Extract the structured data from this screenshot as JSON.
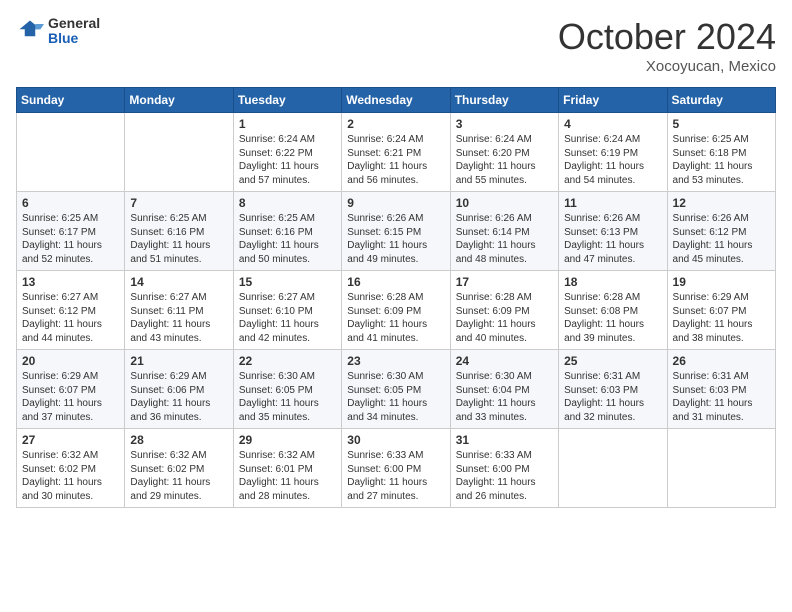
{
  "header": {
    "logo_general": "General",
    "logo_blue": "Blue",
    "month_title": "October 2024",
    "location": "Xocoyucan, Mexico"
  },
  "weekdays": [
    "Sunday",
    "Monday",
    "Tuesday",
    "Wednesday",
    "Thursday",
    "Friday",
    "Saturday"
  ],
  "weeks": [
    [
      {
        "day": "",
        "info": ""
      },
      {
        "day": "",
        "info": ""
      },
      {
        "day": "1",
        "info": "Sunrise: 6:24 AM\nSunset: 6:22 PM\nDaylight: 11 hours and 57 minutes."
      },
      {
        "day": "2",
        "info": "Sunrise: 6:24 AM\nSunset: 6:21 PM\nDaylight: 11 hours and 56 minutes."
      },
      {
        "day": "3",
        "info": "Sunrise: 6:24 AM\nSunset: 6:20 PM\nDaylight: 11 hours and 55 minutes."
      },
      {
        "day": "4",
        "info": "Sunrise: 6:24 AM\nSunset: 6:19 PM\nDaylight: 11 hours and 54 minutes."
      },
      {
        "day": "5",
        "info": "Sunrise: 6:25 AM\nSunset: 6:18 PM\nDaylight: 11 hours and 53 minutes."
      }
    ],
    [
      {
        "day": "6",
        "info": "Sunrise: 6:25 AM\nSunset: 6:17 PM\nDaylight: 11 hours and 52 minutes."
      },
      {
        "day": "7",
        "info": "Sunrise: 6:25 AM\nSunset: 6:16 PM\nDaylight: 11 hours and 51 minutes."
      },
      {
        "day": "8",
        "info": "Sunrise: 6:25 AM\nSunset: 6:16 PM\nDaylight: 11 hours and 50 minutes."
      },
      {
        "day": "9",
        "info": "Sunrise: 6:26 AM\nSunset: 6:15 PM\nDaylight: 11 hours and 49 minutes."
      },
      {
        "day": "10",
        "info": "Sunrise: 6:26 AM\nSunset: 6:14 PM\nDaylight: 11 hours and 48 minutes."
      },
      {
        "day": "11",
        "info": "Sunrise: 6:26 AM\nSunset: 6:13 PM\nDaylight: 11 hours and 47 minutes."
      },
      {
        "day": "12",
        "info": "Sunrise: 6:26 AM\nSunset: 6:12 PM\nDaylight: 11 hours and 45 minutes."
      }
    ],
    [
      {
        "day": "13",
        "info": "Sunrise: 6:27 AM\nSunset: 6:12 PM\nDaylight: 11 hours and 44 minutes."
      },
      {
        "day": "14",
        "info": "Sunrise: 6:27 AM\nSunset: 6:11 PM\nDaylight: 11 hours and 43 minutes."
      },
      {
        "day": "15",
        "info": "Sunrise: 6:27 AM\nSunset: 6:10 PM\nDaylight: 11 hours and 42 minutes."
      },
      {
        "day": "16",
        "info": "Sunrise: 6:28 AM\nSunset: 6:09 PM\nDaylight: 11 hours and 41 minutes."
      },
      {
        "day": "17",
        "info": "Sunrise: 6:28 AM\nSunset: 6:09 PM\nDaylight: 11 hours and 40 minutes."
      },
      {
        "day": "18",
        "info": "Sunrise: 6:28 AM\nSunset: 6:08 PM\nDaylight: 11 hours and 39 minutes."
      },
      {
        "day": "19",
        "info": "Sunrise: 6:29 AM\nSunset: 6:07 PM\nDaylight: 11 hours and 38 minutes."
      }
    ],
    [
      {
        "day": "20",
        "info": "Sunrise: 6:29 AM\nSunset: 6:07 PM\nDaylight: 11 hours and 37 minutes."
      },
      {
        "day": "21",
        "info": "Sunrise: 6:29 AM\nSunset: 6:06 PM\nDaylight: 11 hours and 36 minutes."
      },
      {
        "day": "22",
        "info": "Sunrise: 6:30 AM\nSunset: 6:05 PM\nDaylight: 11 hours and 35 minutes."
      },
      {
        "day": "23",
        "info": "Sunrise: 6:30 AM\nSunset: 6:05 PM\nDaylight: 11 hours and 34 minutes."
      },
      {
        "day": "24",
        "info": "Sunrise: 6:30 AM\nSunset: 6:04 PM\nDaylight: 11 hours and 33 minutes."
      },
      {
        "day": "25",
        "info": "Sunrise: 6:31 AM\nSunset: 6:03 PM\nDaylight: 11 hours and 32 minutes."
      },
      {
        "day": "26",
        "info": "Sunrise: 6:31 AM\nSunset: 6:03 PM\nDaylight: 11 hours and 31 minutes."
      }
    ],
    [
      {
        "day": "27",
        "info": "Sunrise: 6:32 AM\nSunset: 6:02 PM\nDaylight: 11 hours and 30 minutes."
      },
      {
        "day": "28",
        "info": "Sunrise: 6:32 AM\nSunset: 6:02 PM\nDaylight: 11 hours and 29 minutes."
      },
      {
        "day": "29",
        "info": "Sunrise: 6:32 AM\nSunset: 6:01 PM\nDaylight: 11 hours and 28 minutes."
      },
      {
        "day": "30",
        "info": "Sunrise: 6:33 AM\nSunset: 6:00 PM\nDaylight: 11 hours and 27 minutes."
      },
      {
        "day": "31",
        "info": "Sunrise: 6:33 AM\nSunset: 6:00 PM\nDaylight: 11 hours and 26 minutes."
      },
      {
        "day": "",
        "info": ""
      },
      {
        "day": "",
        "info": ""
      }
    ]
  ]
}
